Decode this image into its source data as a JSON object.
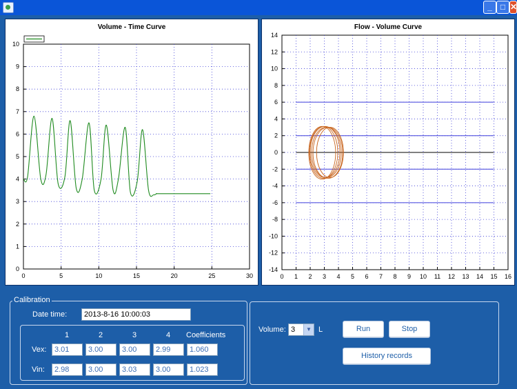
{
  "window": {
    "min_symbol": "_",
    "max_symbol": "□",
    "close_symbol": "✕"
  },
  "vt_chart": {
    "title": "Volume - Time Curve",
    "chart_data": {
      "type": "line",
      "title": "Volume - Time Curve",
      "xlim": [
        0,
        30
      ],
      "ylim": [
        0,
        10
      ],
      "xticks": [
        "0",
        "5",
        "10",
        "15",
        "20",
        "25",
        "30"
      ],
      "yticks": [
        "0",
        "1",
        "2",
        "3",
        "4",
        "5",
        "6",
        "7",
        "8",
        "9",
        "10"
      ],
      "grid": true,
      "legend": "top-left",
      "series": [
        {
          "color": "#1e8a1e",
          "x": [
            0,
            0.55,
            1.4,
            2.3,
            3.0,
            3.8,
            4.6,
            5.5,
            6.2,
            7.0,
            7.8,
            8.7,
            9.4,
            10.3,
            11.0,
            11.9,
            12.6,
            13.5,
            14.2,
            15.1,
            15.8,
            16.6,
            17.3,
            17.7,
            18.3,
            24.8
          ],
          "y": [
            4.0,
            4.1,
            6.8,
            4.0,
            4.2,
            6.7,
            3.8,
            4.1,
            6.6,
            3.6,
            4.0,
            6.5,
            3.5,
            4.0,
            6.4,
            3.5,
            4.0,
            6.3,
            3.4,
            3.9,
            6.2,
            3.5,
            3.3,
            3.35,
            3.35,
            3.35
          ]
        }
      ]
    }
  },
  "fv_chart": {
    "title": "Flow - Volume Curve",
    "chart_data": {
      "type": "line",
      "title": "Flow - Volume Curve",
      "xlim": [
        0,
        16
      ],
      "ylim": [
        -14,
        14
      ],
      "xticks": [
        "0",
        "1",
        "2",
        "3",
        "4",
        "5",
        "6",
        "7",
        "8",
        "9",
        "10",
        "11",
        "12",
        "13",
        "14",
        "15",
        "16"
      ],
      "yticks": [
        "14",
        "12",
        "10",
        "8",
        "6",
        "4",
        "2",
        "0",
        "-2",
        "-4",
        "-6",
        "-8",
        "-10",
        "-12",
        "-14"
      ],
      "grid": true,
      "reference_lines_y": [
        6,
        2,
        0,
        -2,
        -6
      ],
      "reference_line_x_range": [
        1,
        15
      ],
      "loops": [
        {
          "cx": 2.85,
          "cy": -0.05,
          "rx": 0.95,
          "ry": 3.15
        },
        {
          "cx": 2.95,
          "cy": 0.0,
          "rx": 1.0,
          "ry": 3.1
        },
        {
          "cx": 3.05,
          "cy": 0.05,
          "rx": 1.05,
          "ry": 3.05
        },
        {
          "cx": 3.15,
          "cy": 0.0,
          "rx": 1.05,
          "ry": 3.0
        },
        {
          "cx": 3.25,
          "cy": -0.05,
          "rx": 1.05,
          "ry": 3.05
        },
        {
          "cx": 3.4,
          "cy": 0.0,
          "rx": 0.95,
          "ry": 3.0
        }
      ],
      "loop_color": "#c8651e",
      "line_color": "#3c3cdc"
    }
  },
  "calibration": {
    "legend": "Calibration",
    "date_label": "Date time:",
    "date_value": "2013-8-16 10:00:03",
    "columns": [
      "1",
      "2",
      "3",
      "4",
      "Coefficients"
    ],
    "rows": [
      {
        "label": "Vex:",
        "values": [
          "3.01",
          "3.00",
          "3.00",
          "2.99"
        ],
        "coefficient": "1.060"
      },
      {
        "label": "Vin:",
        "values": [
          "2.98",
          "3.00",
          "3.03",
          "3.00"
        ],
        "coefficient": "1.023"
      }
    ]
  },
  "controls": {
    "volume_label": "Volume:",
    "volume_value": "3",
    "volume_unit": "L",
    "run_label": "Run",
    "stop_label": "Stop",
    "history_label": "History records"
  }
}
